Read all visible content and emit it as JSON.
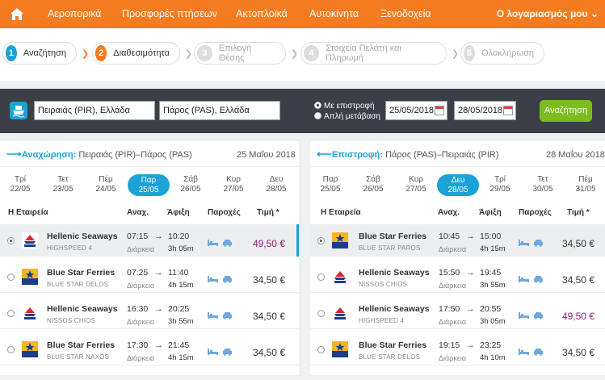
{
  "nav": {
    "items": [
      "Αεροπορικά",
      "Προσφορές πτήσεων",
      "Ακτοπλοϊκά",
      "Αυτοκίνητα",
      "Ξενοδοχεία"
    ],
    "account": "Ο λογαριασμός μου ⌄",
    "brand_color": "#f47b20"
  },
  "steps": [
    {
      "num": "1",
      "label": "Αναζήτηση"
    },
    {
      "num": "2",
      "label": "Διαθεσιμότητα"
    },
    {
      "num": "3",
      "label": "Επιλογή Θέσης"
    },
    {
      "num": "4",
      "label": "Στοιχεία Πελάτη και Πληρωμή"
    },
    {
      "num": "5",
      "label": "Ολοκλήρωση"
    }
  ],
  "search": {
    "from": "Πειραιάς (PIR), Ελλάδα",
    "to": "Πάρος (PAS), Ελλάδα",
    "opt_return": "Με επιστροφή",
    "opt_oneway": "Απλή μετάβαση",
    "date_out": "25/05/2018",
    "date_back": "28/05/2018",
    "button": "Αναζήτηση"
  },
  "outbound": {
    "title_bold": "Αναχώρηση:",
    "route": "Πειραιάς (PIR)–Πάρος (PAS)",
    "date": "25 Μαΐου 2018",
    "days": [
      {
        "d": "Τρί",
        "n": "22/05"
      },
      {
        "d": "Τετ",
        "n": "23/05"
      },
      {
        "d": "Πέμ",
        "n": "24/05"
      },
      {
        "d": "Παρ",
        "n": "25/05"
      },
      {
        "d": "Σάβ",
        "n": "26/05"
      },
      {
        "d": "Κυρ",
        "n": "27/05"
      },
      {
        "d": "Δευ",
        "n": "28/05"
      }
    ],
    "rows": [
      {
        "company": "Hellenic Seaways",
        "vessel": "HIGHSPEED 4",
        "dep": "07:15",
        "arr": "10:20",
        "dur": "3h 05m",
        "price": "49,50 €"
      },
      {
        "company": "Blue Star Ferries",
        "vessel": "BLUE STAR DELOS",
        "dep": "07:25",
        "arr": "11:40",
        "dur": "4h 15m",
        "price": "34,50 €"
      },
      {
        "company": "Hellenic Seaways",
        "vessel": "NISSOS CHIOS",
        "dep": "16:30",
        "arr": "20:25",
        "dur": "3h 55m",
        "price": "34,50 €"
      },
      {
        "company": "Blue Star Ferries",
        "vessel": "BLUE STAR NAXOS",
        "dep": "17:30",
        "arr": "21:45",
        "dur": "4h 15m",
        "price": "34,50 €"
      }
    ]
  },
  "inbound": {
    "title_bold": "Επιστροφή:",
    "route": "Πάρος (PAS)–Πειραιάς (PIR)",
    "date": "28 Μαΐου 2018",
    "days": [
      {
        "d": "Παρ",
        "n": "25/05"
      },
      {
        "d": "Σάβ",
        "n": "26/05"
      },
      {
        "d": "Κυρ",
        "n": "27/05"
      },
      {
        "d": "Δευ",
        "n": "28/05"
      },
      {
        "d": "Τρί",
        "n": "29/05"
      },
      {
        "d": "Τετ",
        "n": "30/05"
      },
      {
        "d": "Πέμ",
        "n": "31/05"
      }
    ],
    "rows": [
      {
        "company": "Blue Star Ferries",
        "vessel": "BLUE STAR PAROS",
        "dep": "10:45",
        "arr": "15:00",
        "dur": "4h 15m",
        "price": "34,50 €"
      },
      {
        "company": "Hellenic Seaways",
        "vessel": "NISSOS CHIOS",
        "dep": "15:50",
        "arr": "19:45",
        "dur": "3h 55m",
        "price": "34,50 €"
      },
      {
        "company": "Hellenic Seaways",
        "vessel": "HIGHSPEED 4",
        "dep": "17:50",
        "arr": "20:55",
        "dur": "3h 05m",
        "price": "49,50 €"
      },
      {
        "company": "Blue Star Ferries",
        "vessel": "BLUE STAR DELOS",
        "dep": "19:15",
        "arr": "23:25",
        "dur": "4h 10m",
        "price": "34,50 €"
      }
    ]
  },
  "columns": {
    "company": "Η Εταιρεία",
    "dep": "Αναχ.",
    "arr": "Άφιξη",
    "amen": "Παροχές",
    "price": "Τιμή",
    "asterisk": "*",
    "duration": "Διάρκεια",
    "arrow": "→"
  }
}
